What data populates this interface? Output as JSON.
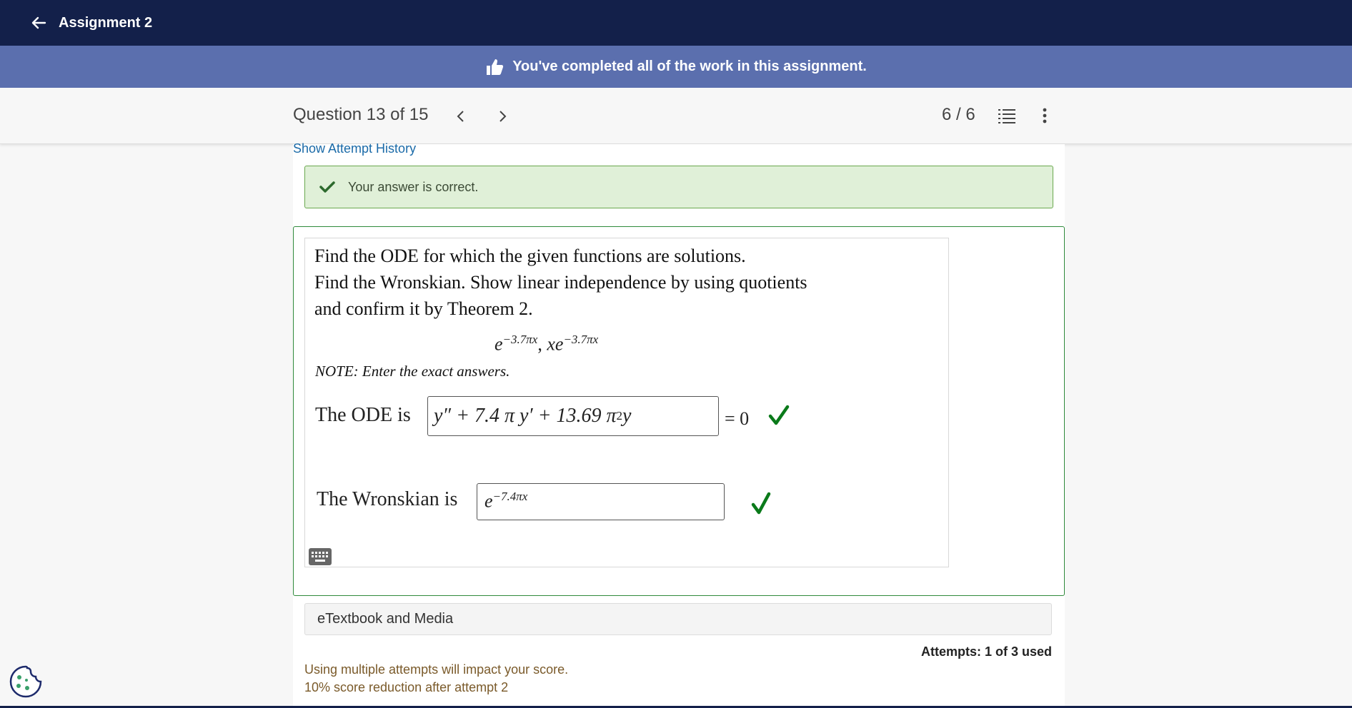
{
  "header": {
    "title": "Assignment 2"
  },
  "banner": {
    "message": "You've completed all of the work in this assignment."
  },
  "question_bar": {
    "label": "Question 13 of 15",
    "score": "6 / 6"
  },
  "attempt_history": {
    "link": "Show Attempt History"
  },
  "feedback": {
    "message": "Your answer is correct."
  },
  "question": {
    "prompt_line1": "Find the ODE for which the given functions are solutions.",
    "prompt_line2": "Find the Wronskian. Show linear independence by using quotients",
    "prompt_line3": "and confirm it by Theorem 2.",
    "functions": {
      "f1_base": "e",
      "f1_exp": "−3.7πx",
      "sep": ", ",
      "f2_base": "xe",
      "f2_exp": "−3.7πx"
    },
    "note": "NOTE: Enter the exact answers.",
    "ode_label": "The ODE is",
    "ode_answer": {
      "part1": "y″ + 7.4 π y′ + 13.69 π",
      "exp": "2",
      "part2": " y"
    },
    "ode_rhs": "= 0",
    "wronskian_label": "The Wronskian is",
    "wronskian_answer": {
      "base": "e",
      "exp": "−7.4πx"
    }
  },
  "etextbook": {
    "label": "eTextbook and Media"
  },
  "attempts": {
    "label": "Attempts: 1 of 3 used"
  },
  "warning": {
    "line1": "Using multiple attempts will impact your score.",
    "line2": "10% score reduction after attempt 2"
  },
  "colors": {
    "header": "#13204a",
    "banner": "#5b6fae",
    "correct": "#2f8a3b",
    "link": "#1a6aa8"
  },
  "icons": [
    "back-arrow-icon",
    "thumbs-up-icon",
    "chevron-left-icon",
    "chevron-right-icon",
    "list-icon",
    "kebab-menu-icon",
    "check-icon",
    "keyboard-icon",
    "cookie-icon"
  ]
}
